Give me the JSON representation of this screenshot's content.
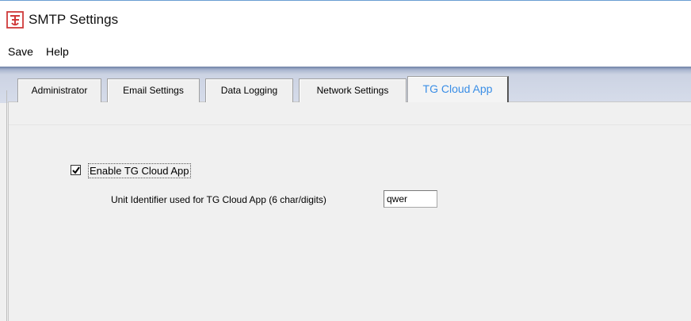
{
  "window": {
    "title": "SMTP Settings",
    "icon": "tg-logo-icon"
  },
  "menu": {
    "items": [
      {
        "label": "Save"
      },
      {
        "label": "Help"
      }
    ]
  },
  "tabs": [
    {
      "label": "Administrator",
      "active": false
    },
    {
      "label": "Email Settings",
      "active": false
    },
    {
      "label": "Data Logging",
      "active": false
    },
    {
      "label": "Network Settings",
      "active": false
    },
    {
      "label": "TG Cloud App",
      "active": true
    }
  ],
  "cloud_app": {
    "enable_label": "Enable TG Cloud App",
    "enable_checked": true,
    "unit_identifier_label": "Unit Identifier used for TG Cloud App (6 char/digits)",
    "unit_identifier_value": "qwer"
  },
  "colors": {
    "active_tab_text": "#3a8ee6",
    "logo": "#d03a3a"
  }
}
